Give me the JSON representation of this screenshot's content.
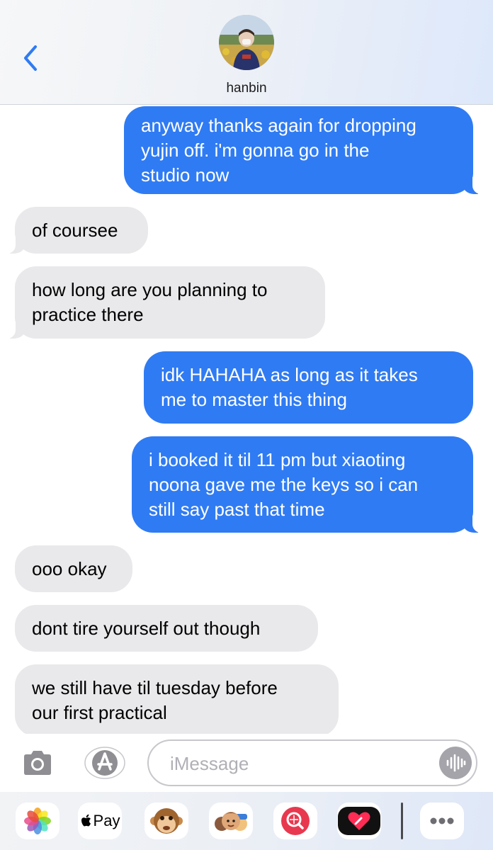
{
  "header": {
    "contact_name": "hanbin",
    "back_icon": "chevron-left-icon",
    "avatar_icon": "contact-avatar-photo"
  },
  "messages": [
    {
      "direction": "outgoing",
      "lines": [
        "anyway thanks again for dropping",
        "yujin off. i'm gonna go in the",
        "studio now"
      ]
    },
    {
      "direction": "incoming",
      "lines": [
        "of coursee"
      ]
    },
    {
      "direction": "incoming",
      "lines": [
        "how long are you planning to",
        "practice there"
      ]
    },
    {
      "direction": "outgoing",
      "lines": [
        "idk HAHAHA as long as it takes",
        "me to master this thing"
      ]
    },
    {
      "direction": "outgoing",
      "lines": [
        "i booked it til 11 pm but xiaoting",
        "noona gave me the keys so i can",
        "still say past that time"
      ]
    },
    {
      "direction": "incoming",
      "lines": [
        "ooo okay"
      ]
    },
    {
      "direction": "incoming",
      "lines": [
        "dont tire yourself out though"
      ]
    },
    {
      "direction": "incoming",
      "lines": [
        "we still have til tuesday before",
        "our first practical"
      ]
    }
  ],
  "composer": {
    "placeholder": "iMessage",
    "camera_icon": "camera-icon",
    "appstore_icon": "app-store-icon",
    "audio_icon": "waveform-icon"
  },
  "app_drawer": {
    "items": [
      {
        "name": "photos-app-icon"
      },
      {
        "name": "apple-pay-icon",
        "label": "Pay"
      },
      {
        "name": "animoji-monkey-icon"
      },
      {
        "name": "memoji-stickers-icon"
      },
      {
        "name": "image-search-icon"
      },
      {
        "name": "digital-touch-icon"
      },
      {
        "name": "more-apps-icon"
      }
    ]
  },
  "colors": {
    "outgoing_bubble": "#2f7bf3",
    "incoming_bubble": "#e9e9eb",
    "accent_blue": "#2f7bf3"
  }
}
